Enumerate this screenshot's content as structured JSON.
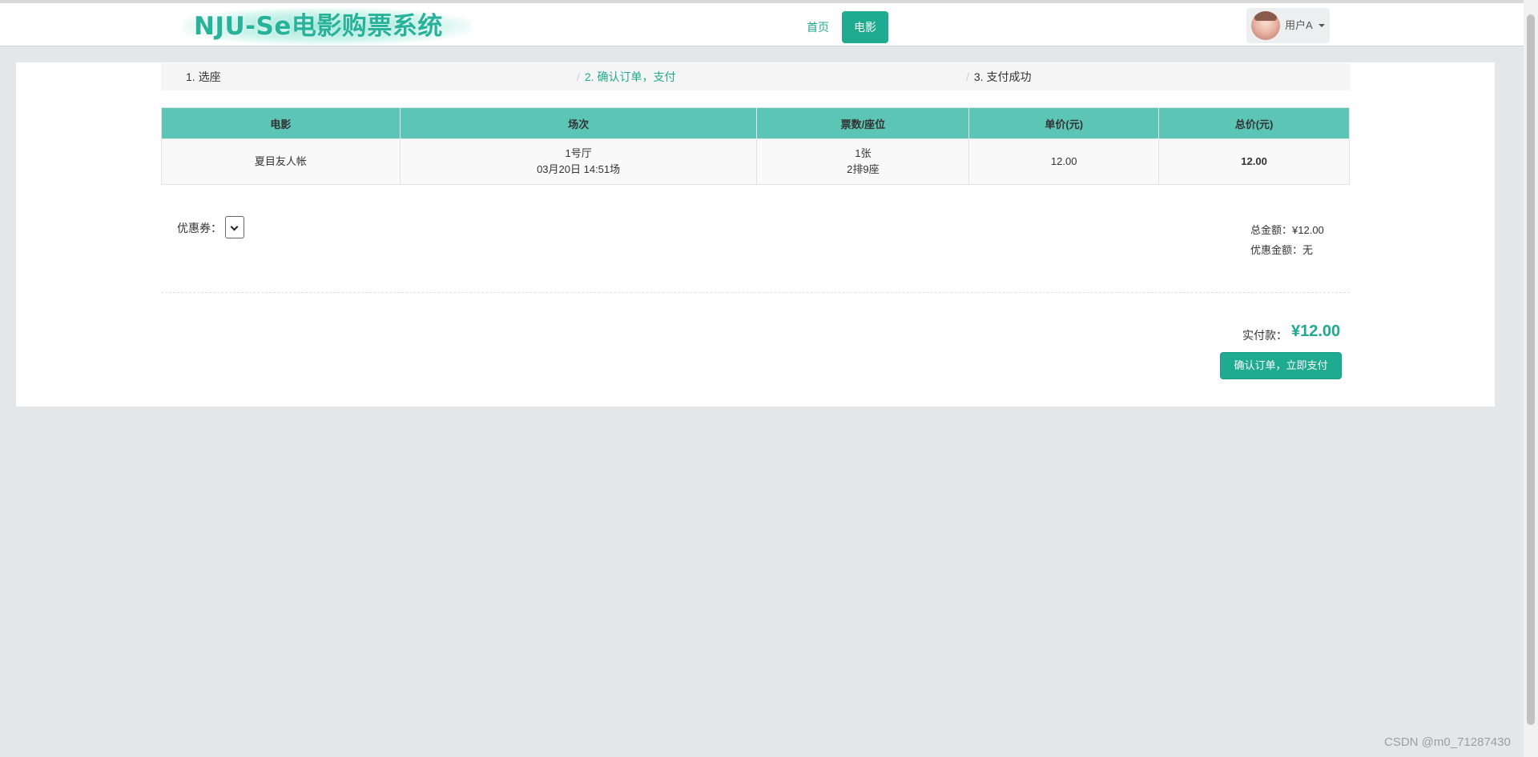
{
  "header": {
    "logo_text": "NJU-Se电影购票系统",
    "nav": {
      "home": "首页",
      "movie": "电影",
      "active": "电影"
    },
    "user": {
      "name": "用户A"
    }
  },
  "steps": [
    {
      "label": "1. 选座",
      "active": false
    },
    {
      "label": "2. 确认订单，支付",
      "active": true
    },
    {
      "label": "3. 支付成功",
      "active": false
    }
  ],
  "step_separator": "/",
  "order_table": {
    "headers": [
      "电影",
      "场次",
      "票数/座位",
      "单价(元)",
      "总价(元)"
    ],
    "rows": [
      {
        "movie": "夏目友人帐",
        "hall": "1号厅",
        "time": "03月20日 14:51场",
        "ticket_count": "1张",
        "seat": "2排9座",
        "unit_price": "12.00",
        "total_price": "12.00"
      }
    ]
  },
  "coupon": {
    "label": "优惠券：",
    "selected": ""
  },
  "summary": {
    "total_label": "总金额：",
    "total_value": "¥12.00",
    "discount_label": "优惠金额：",
    "discount_value": "无"
  },
  "payment": {
    "label": "实付款：",
    "amount": "¥12.00",
    "confirm_button": "确认订单，立即支付"
  },
  "watermark": "CSDN @m0_71287430",
  "colors": {
    "accent": "#1fab8f",
    "table_header": "#5dc5b5",
    "background": "#e3e7ea"
  }
}
